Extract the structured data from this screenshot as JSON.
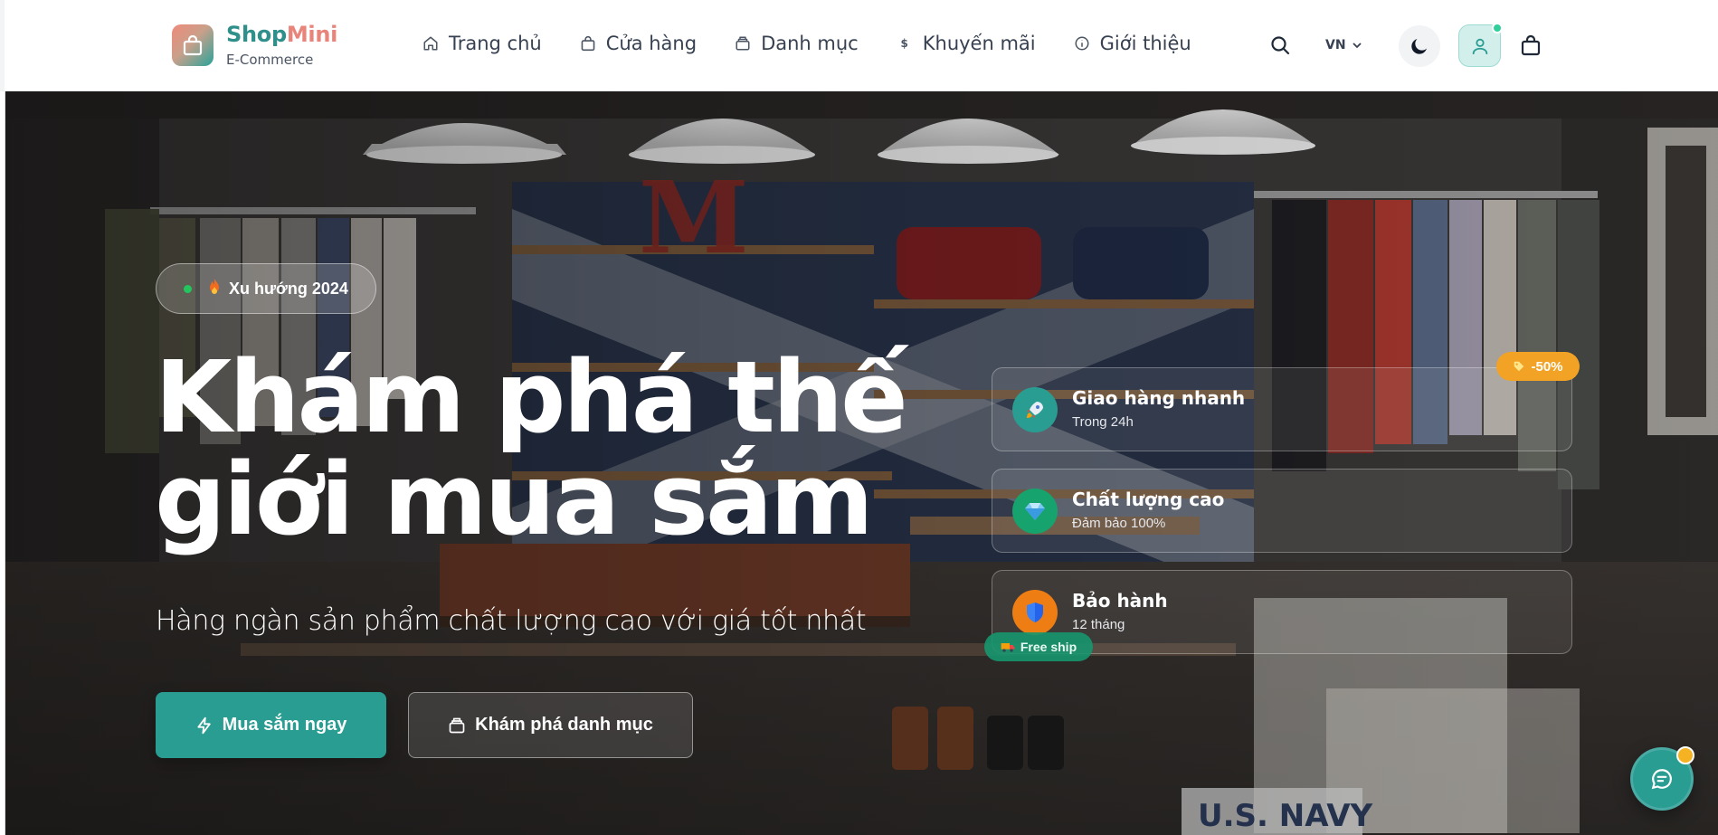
{
  "brand": {
    "name_part1": "Shop",
    "name_part2": "Mini",
    "subtitle": "E-Commerce",
    "icon": "shopping-bag-icon"
  },
  "nav": {
    "items": [
      {
        "label": "Trang chủ",
        "icon": "home-icon"
      },
      {
        "label": "Cửa hàng",
        "icon": "shopping-bag-icon"
      },
      {
        "label": "Danh mục",
        "icon": "layers-icon"
      },
      {
        "label": "Khuyến mãi",
        "icon": "dollar-icon"
      },
      {
        "label": "Giới thiệu",
        "icon": "info-icon"
      }
    ]
  },
  "toolbar": {
    "language": "VN",
    "icons": [
      "search-icon",
      "moon-icon",
      "user-icon",
      "cart-bag-icon"
    ]
  },
  "hero": {
    "trend_badge": "Xu hướng 2024",
    "headline_line1": "Khám phá thế",
    "headline_line2": "giới mua sắm",
    "subtitle": "Hàng ngàn sản phẩm chất lượng cao với giá tốt nhất",
    "primary_button": "Mua sắm ngay",
    "secondary_button": "Khám phá danh mục",
    "sale_badge": "-50%",
    "free_ship_badge": "Free ship",
    "features": [
      {
        "title": "Giao hàng nhanh",
        "subtitle": "Trong 24h",
        "icon": "rocket-icon",
        "color": "#2a9d93"
      },
      {
        "title": "Chất lượng cao",
        "subtitle": "Đảm bảo 100%",
        "icon": "diamond-icon",
        "color": "#16a36d"
      },
      {
        "title": "Bảo hành",
        "subtitle": "12 tháng",
        "icon": "shield-icon",
        "color": "#ee7d14"
      }
    ]
  },
  "colors": {
    "primary": "#2a9d93",
    "accent": "#e9847a",
    "sale": "#f2a325",
    "online": "#2fcf9c"
  }
}
